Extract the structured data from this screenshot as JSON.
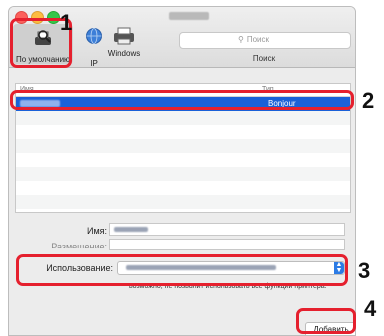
{
  "toolbar": {
    "default_label": "По умолчанию",
    "ip_label": "IP",
    "windows_label": "Windows",
    "search_placeholder": "Поиск",
    "search_caption": "Поиск"
  },
  "table": {
    "col_name": "Имя",
    "col_type": "Тип",
    "rows": [
      {
        "type": "Bonjour",
        "selected": true
      },
      {
        "type": ""
      },
      {
        "type": ""
      },
      {
        "type": ""
      },
      {
        "type": ""
      },
      {
        "type": ""
      },
      {
        "type": ""
      },
      {
        "type": ""
      }
    ]
  },
  "form": {
    "name_label": "Имя:",
    "location_label": "Размещение:",
    "use_label": "Использование:",
    "note": "возможно, не позволит использовать все функции принтера."
  },
  "add_button": "Добавить",
  "callouts": [
    "1",
    "2",
    "3",
    "4"
  ],
  "colors": {
    "callout": "#e5202e",
    "selection": "#1a61d8",
    "select_arrow": "#2c7be5"
  }
}
